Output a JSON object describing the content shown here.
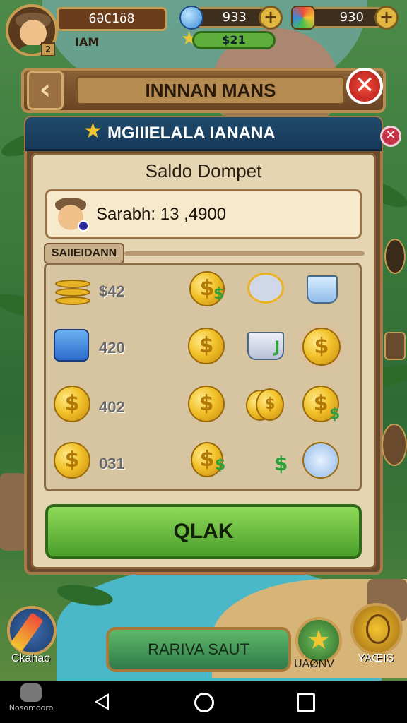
{
  "hud": {
    "player_name": "6ƏC1ö8",
    "player_sub": "IAM",
    "level": "2",
    "gems": "933",
    "gems_sub": "$21",
    "gold": "930"
  },
  "title": "INNNAN MANS",
  "panel": {
    "header": "MGIIIELALA IANANA",
    "saldo_label": "Saldo Dompet",
    "balance_text": "Sarabh: 13 ,4900",
    "section_tag": "SAIIEIDANN",
    "amounts": [
      "$42",
      "420",
      "402",
      "031"
    ],
    "ok_label": "QLAK"
  },
  "bottom": {
    "main_button": "RARIVA SAUT",
    "left_label": "Ckahao",
    "right_label_1": "UAØNV",
    "right_label_2": "YAŒIS"
  },
  "watermark": "Nosomooro",
  "icons": {
    "back": "chevron-left-icon",
    "close": "close-icon",
    "star": "star-icon",
    "plus": "plus-icon",
    "coin": "coin-icon",
    "dollar": "dollar-icon"
  },
  "colors": {
    "ok_green": "#5fae3c",
    "close_red": "#d02a22",
    "header_blue": "#1f4a6a",
    "panel_parchment": "#e6d5b2"
  }
}
